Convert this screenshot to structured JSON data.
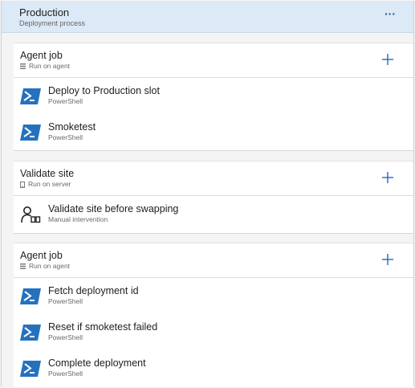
{
  "stage": {
    "title": "Production",
    "subtitle": "Deployment process",
    "more_label": "···"
  },
  "phases": [
    {
      "title": "Agent job",
      "subtitle": "Run on agent",
      "subtitle_icon": "list-icon",
      "tasks": [
        {
          "name": "Deploy to Production slot",
          "type": "PowerShell",
          "icon": "powershell-icon"
        },
        {
          "name": "Smoketest",
          "type": "PowerShell",
          "icon": "powershell-icon"
        }
      ]
    },
    {
      "title": "Validate site",
      "subtitle": "Run on server",
      "subtitle_icon": "server-icon",
      "tasks": [
        {
          "name": "Validate site before swapping",
          "type": "Manual intervention",
          "icon": "manual-intervention-icon"
        }
      ]
    },
    {
      "title": "Agent job",
      "subtitle": "Run on agent",
      "subtitle_icon": "list-icon",
      "tasks": [
        {
          "name": "Fetch deployment id",
          "type": "PowerShell",
          "icon": "powershell-icon"
        },
        {
          "name": "Reset if smoketest failed",
          "type": "PowerShell",
          "icon": "powershell-icon"
        },
        {
          "name": "Complete deployment",
          "type": "PowerShell",
          "icon": "powershell-icon"
        }
      ]
    }
  ],
  "colors": {
    "header_bg": "#dce9f6",
    "accent": "#1e4f8c",
    "powershell": "#2671be"
  }
}
